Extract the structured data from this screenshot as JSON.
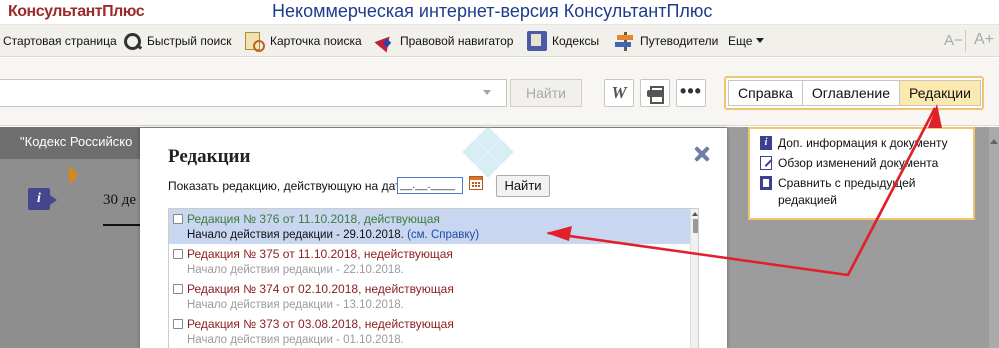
{
  "header": {
    "logo": "КонсультантПлюс",
    "title": "Некоммерческая интернет-версия КонсультантПлюс"
  },
  "toolbar": {
    "items": [
      {
        "label": "Стартовая страница",
        "icon": "home"
      },
      {
        "label": "Быстрый поиск",
        "icon": "search-icon"
      },
      {
        "label": "Карточка поиска",
        "icon": "search-card-icon"
      },
      {
        "label": "Правовой навигатор",
        "icon": "navigator-icon"
      },
      {
        "label": "Кодексы",
        "icon": "codes-book-icon"
      },
      {
        "label": "Путеводители",
        "icon": "signpost-icon"
      }
    ],
    "more_label": "Еще",
    "font_decrease": "A−",
    "font_increase": "A+"
  },
  "search": {
    "find_label": "Найти",
    "word_button": "W",
    "more_button": "•••"
  },
  "tabs": [
    {
      "label": "Справка",
      "active": false
    },
    {
      "label": "Оглавление",
      "active": false
    },
    {
      "label": "Редакции",
      "active": true
    }
  ],
  "document": {
    "title": "\"Кодекс Российско",
    "text": "30 де"
  },
  "side_panel": {
    "items": [
      {
        "label": "Доп. информация к документу",
        "icon": "info-icon"
      },
      {
        "label": "Обзор изменений документа",
        "icon": "edit-icon"
      },
      {
        "label": "Сравнить с предыдущей редакцией",
        "icon": "compare-icon"
      }
    ]
  },
  "modal": {
    "title": "Редакции",
    "date_label": "Показать редакцию, действующую на дату:",
    "date_value": "__.__.____",
    "find_label": "Найти",
    "editions": [
      {
        "title": "Редакция № 376 от 11.10.2018, действующая",
        "start": "Начало действия редакции - 29.10.2018.",
        "link": "(см. Справку)",
        "active": true,
        "selected": true
      },
      {
        "title": "Редакция № 375 от 11.10.2018, недействующая",
        "start": "Начало действия редакции - 22.10.2018.",
        "link": "",
        "active": false,
        "selected": false
      },
      {
        "title": "Редакция № 374 от 02.10.2018, недействующая",
        "start": "Начало действия редакции - 13.10.2018.",
        "link": "",
        "active": false,
        "selected": false
      },
      {
        "title": "Редакция № 373 от 03.08.2018, недействующая",
        "start": "Начало действия редакции - 01.10.2018.",
        "link": "",
        "active": false,
        "selected": false
      }
    ]
  },
  "colors": {
    "accent_orange": "#f3c36e",
    "arrow_red": "#e0202a",
    "title_blue": "#1e3c8c",
    "selected_row": "#c9d6f0"
  }
}
